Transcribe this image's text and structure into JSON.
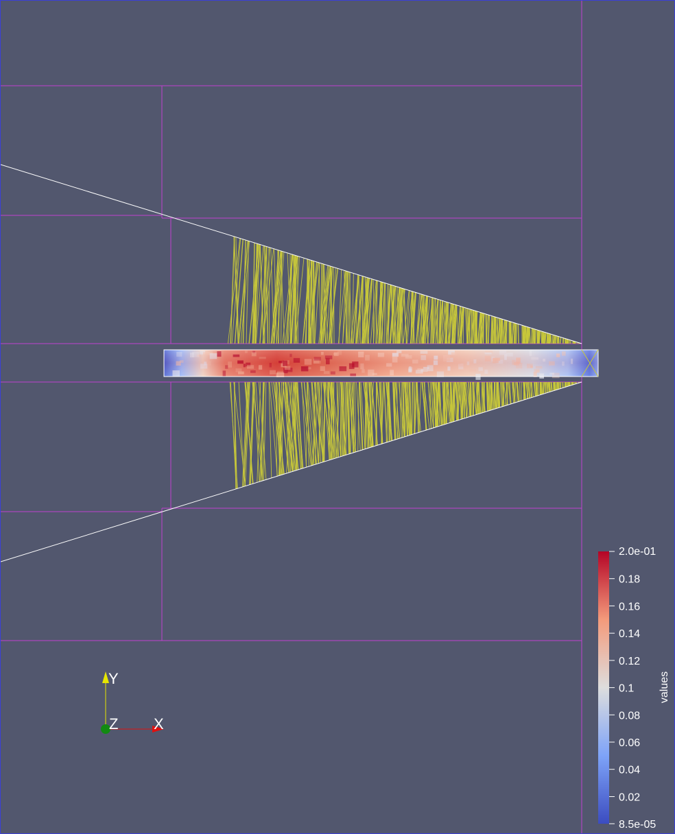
{
  "colorbar": {
    "title": "values",
    "max_label": "2.0e-01",
    "min_label": "8.5e-05",
    "ticks": [
      "0.18",
      "0.16",
      "0.14",
      "0.12",
      "0.1",
      "0.08",
      "0.06",
      "0.04",
      "0.02"
    ]
  },
  "axes": {
    "x_label": "X",
    "y_label": "Y",
    "z_label": "Z"
  },
  "colors": {
    "background": "#52576e",
    "grid": "#c040d0",
    "rays": "#c8c83a",
    "outline": "#ffffff",
    "cold": "#3b4cc0",
    "neutral": "#dddddd",
    "hot": "#b40426"
  }
}
